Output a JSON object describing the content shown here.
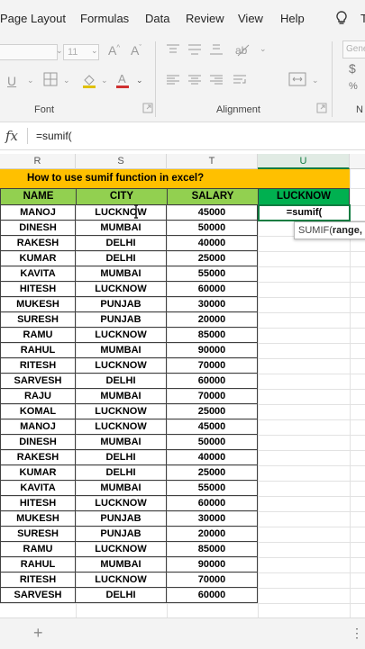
{
  "menu": {
    "items": [
      "Page Layout",
      "Formulas",
      "Data",
      "Review",
      "View",
      "Help"
    ],
    "cut_tab": "T"
  },
  "ribbon": {
    "font_size_value": "11",
    "font_group_label": "Font",
    "alignment_group_label": "Alignment",
    "number_format_value": "Gene",
    "cut_group_label": "N"
  },
  "formula_bar": {
    "fx_label": "fx",
    "content": "=sumif("
  },
  "columns": [
    "R",
    "S",
    "T",
    "U"
  ],
  "sheet": {
    "title": "How to use sumif function in excel?",
    "headers": [
      "NAME",
      "CITY",
      "SALARY",
      "LUCKNOW"
    ],
    "rows": [
      [
        "MANOJ",
        "LUCKNOW",
        "45000"
      ],
      [
        "DINESH",
        "MUMBAI",
        "50000"
      ],
      [
        "RAKESH",
        "DELHI",
        "40000"
      ],
      [
        "KUMAR",
        "DELHI",
        "25000"
      ],
      [
        "KAVITA",
        "MUMBAI",
        "55000"
      ],
      [
        "HITESH",
        "LUCKNOW",
        "60000"
      ],
      [
        "MUKESH",
        "PUNJAB",
        "30000"
      ],
      [
        "SURESH",
        "PUNJAB",
        "20000"
      ],
      [
        "RAMU",
        "LUCKNOW",
        "85000"
      ],
      [
        "RAHUL",
        "MUMBAI",
        "90000"
      ],
      [
        "RITESH",
        "LUCKNOW",
        "70000"
      ],
      [
        "SARVESH",
        "DELHI",
        "60000"
      ],
      [
        "RAJU",
        "MUMBAI",
        "70000"
      ],
      [
        "KOMAL",
        "LUCKNOW",
        "25000"
      ],
      [
        "MANOJ",
        "LUCKNOW",
        "45000"
      ],
      [
        "DINESH",
        "MUMBAI",
        "50000"
      ],
      [
        "RAKESH",
        "DELHI",
        "40000"
      ],
      [
        "KUMAR",
        "DELHI",
        "25000"
      ],
      [
        "KAVITA",
        "MUMBAI",
        "55000"
      ],
      [
        "HITESH",
        "LUCKNOW",
        "60000"
      ],
      [
        "MUKESH",
        "PUNJAB",
        "30000"
      ],
      [
        "SURESH",
        "PUNJAB",
        "20000"
      ],
      [
        "RAMU",
        "LUCKNOW",
        "85000"
      ],
      [
        "RAHUL",
        "MUMBAI",
        "90000"
      ],
      [
        "RITESH",
        "LUCKNOW",
        "70000"
      ],
      [
        "SARVESH",
        "DELHI",
        "60000"
      ]
    ],
    "active_cell_value": "=sumif(",
    "tooltip_prefix": "SUMIF(",
    "tooltip_arg": "range,"
  },
  "colors": {
    "title_fill": "#ffc000",
    "header_fill": "#92d050",
    "lucknow_header_fill": "#00b050",
    "selection": "#107c41"
  },
  "icons": [
    "lightbulb-icon",
    "bold-icon",
    "underline-icon",
    "borders-icon",
    "fill-color-icon",
    "font-color-icon",
    "align-icon",
    "currency-icon",
    "add-sheet-icon",
    "more-options-icon",
    "mouse-cursor-icon"
  ]
}
